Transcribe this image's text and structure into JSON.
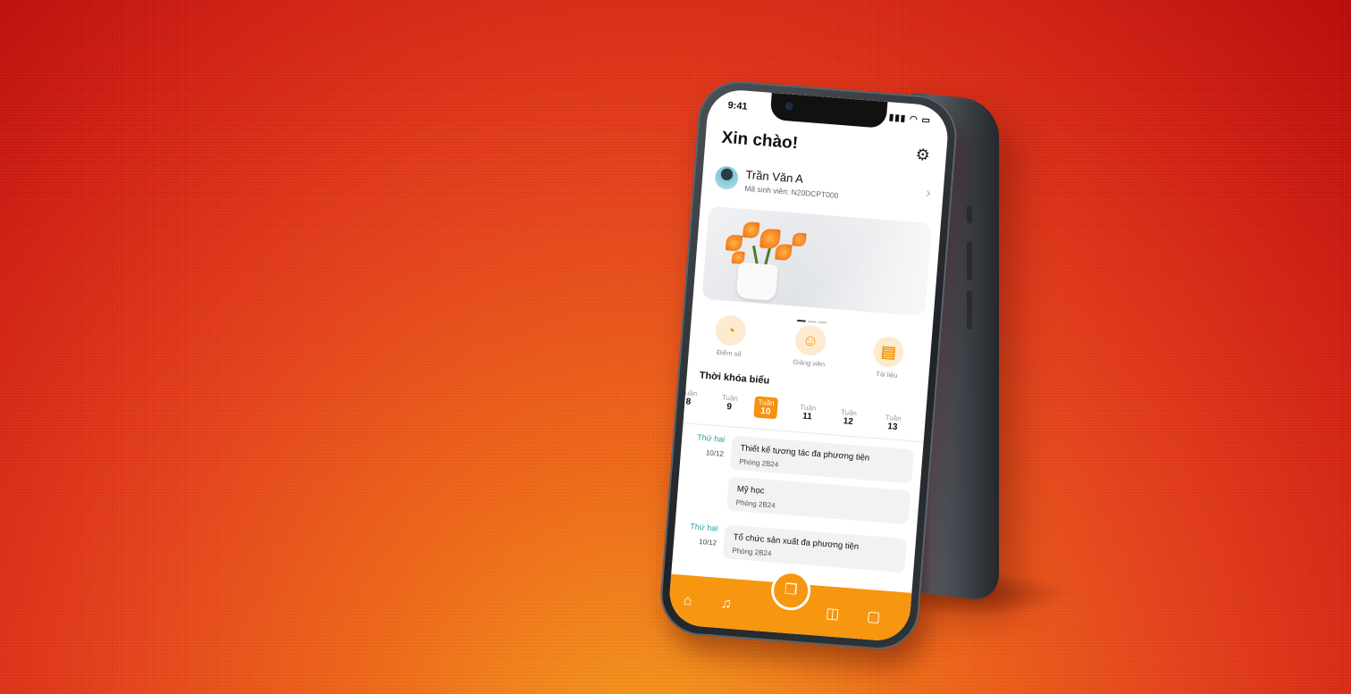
{
  "status_bar": {
    "time": "9:41",
    "icons": "▮▮▮ ◠ ▭"
  },
  "header": {
    "greeting": "Xin chào!",
    "settings_icon": "gear-icon"
  },
  "profile": {
    "name": "Trần Văn A",
    "student_id": "Mã sinh viên: N20DCPT000"
  },
  "banner": {
    "pages": 3,
    "active_page": 1
  },
  "quick_actions": [
    {
      "label": "Điểm số",
      "icon": "chart-icon"
    },
    {
      "label": "Giảng viên",
      "icon": "person-icon"
    },
    {
      "label": "Tài liệu",
      "icon": "document-icon"
    }
  ],
  "schedule": {
    "title": "Thời khóa biểu",
    "weeks": [
      {
        "label": "Tuần",
        "number": "8"
      },
      {
        "label": "Tuần",
        "number": "9"
      },
      {
        "label": "Tuần",
        "number": "10",
        "active": true
      },
      {
        "label": "Tuần",
        "number": "11"
      },
      {
        "label": "Tuần",
        "number": "12"
      },
      {
        "label": "Tuần",
        "number": "13"
      }
    ],
    "days": [
      {
        "name": "Thứ hai",
        "date": "10/12",
        "courses": [
          {
            "name": "Thiết kế tương tác đa phương tiện",
            "room": "Phòng 2B24"
          },
          {
            "name": "Mỹ học",
            "room": "Phòng 2B24"
          }
        ]
      },
      {
        "name": "Thứ hai",
        "date": "10/12",
        "courses": [
          {
            "name": "Tổ chức sản xuất đa phương tiện",
            "room": "Phòng 2B24"
          }
        ]
      }
    ]
  },
  "tabbar": {
    "home_icon": "⌂",
    "bell_icon": "♫",
    "center_icon": "❒",
    "bag_icon": "◫",
    "chat_icon": "▢"
  },
  "colors": {
    "accent": "#f7960f",
    "teal": "#1aa3a3",
    "bg_top": "#b70a08",
    "bg_bottom": "#f6a21c"
  }
}
